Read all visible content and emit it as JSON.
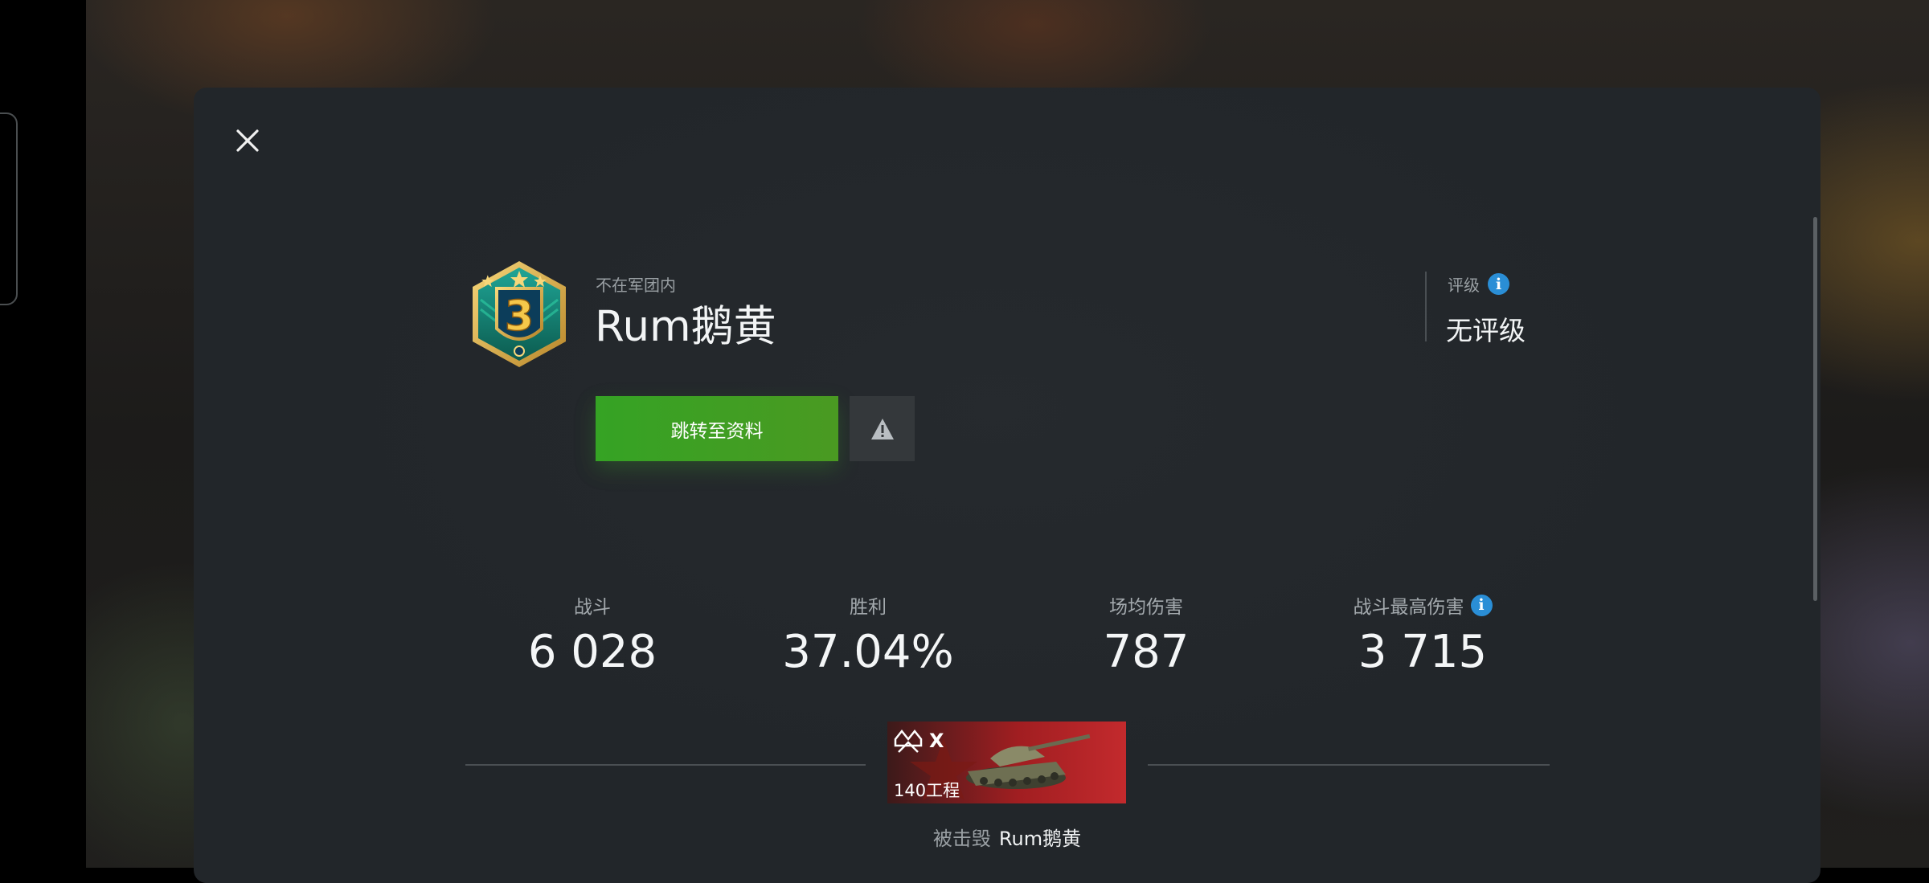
{
  "dialog": {
    "close_icon": "close-icon",
    "clan_status": "不在军团内",
    "player_name": "Rum鹅黄",
    "profile_button_label": "跳转至资料",
    "report_icon": "warning-icon"
  },
  "rating": {
    "label": "评级",
    "value": "无评级",
    "info_icon": "i"
  },
  "stats": [
    {
      "label": "战斗",
      "value": "6 028"
    },
    {
      "label": "胜利",
      "value": "37.04%"
    },
    {
      "label": "场均伤害",
      "value": "787"
    },
    {
      "label": "战斗最高伤害",
      "value": "3 715",
      "info_icon": "i"
    }
  ],
  "tank": {
    "tier": "X",
    "name": "140工程"
  },
  "destroyed": {
    "prefix": "被击毁",
    "by": "Rum鹅黄"
  },
  "colors": {
    "accent_green": "#3a9e23",
    "info_blue": "#2a8ed6",
    "tank_red": "#a11e21"
  }
}
